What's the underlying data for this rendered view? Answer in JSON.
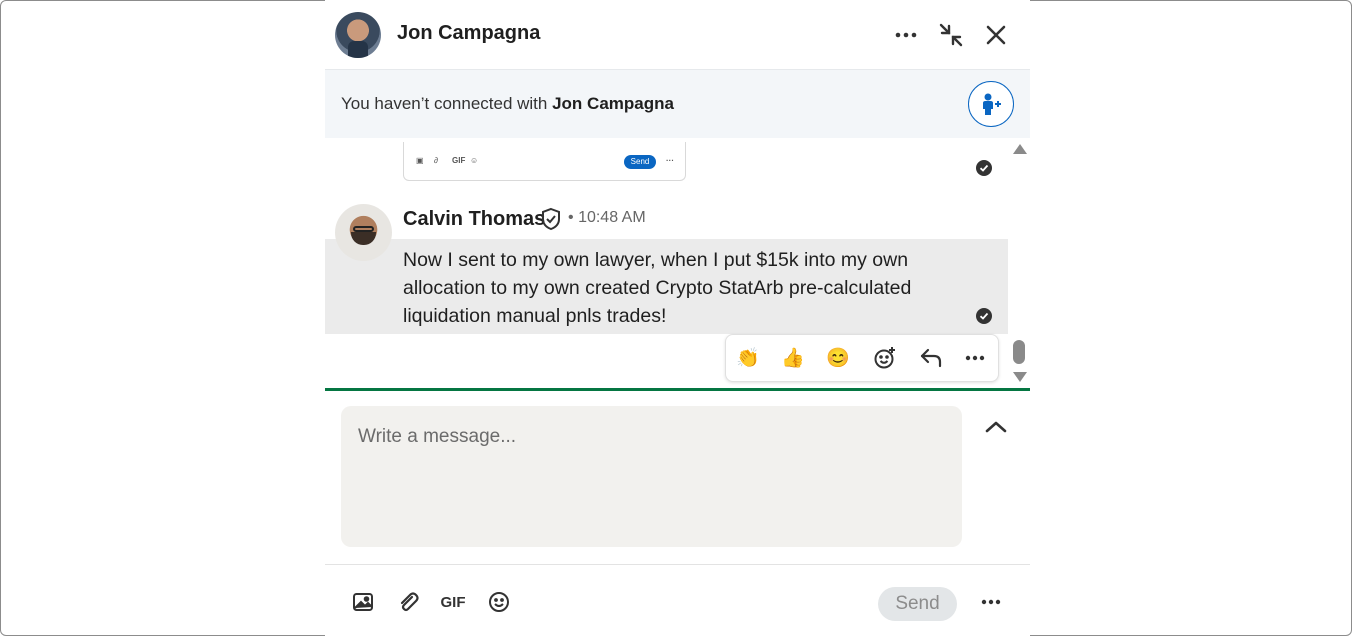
{
  "header": {
    "name": "Jon Campagna",
    "avatar_icon": "profile-photo",
    "more_icon": "ellipsis-icon",
    "minimize_icon": "collapse-arrows-icon",
    "close_icon": "close-icon"
  },
  "connect_banner": {
    "prefix": "You haven’t connected with ",
    "name": "Jon Campagna",
    "button_icon": "add-person-icon"
  },
  "previous_message_preview": {
    "send_label": "Send",
    "gif_label": "GIF"
  },
  "message": {
    "sender": "Calvin Thomas",
    "separator": "•",
    "time": "10:48 AM",
    "body": "Now I sent to my own lawyer, when I put $15k into my own allocation to my own created Crypto StatArb pre-calculated liquidation manual pnls trades!"
  },
  "reactions": {
    "items": [
      "👏",
      "👍",
      "😊"
    ]
  },
  "compose": {
    "placeholder": "Write a message..."
  },
  "footer": {
    "gif_label": "GIF",
    "send_label": "Send"
  },
  "colors": {
    "accent": "#0a66c2",
    "divider_green": "#057642",
    "highlight": "#ebebeb",
    "compose_bg": "#f2f1ee"
  }
}
